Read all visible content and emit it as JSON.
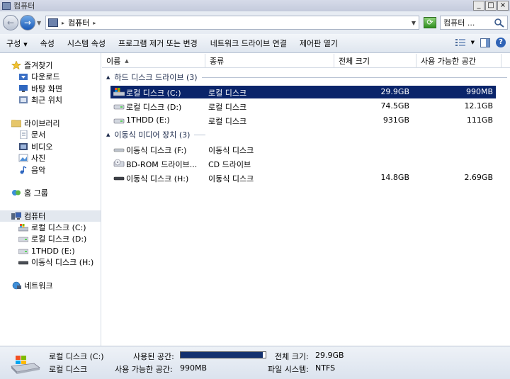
{
  "window": {
    "title": "컴퓨터",
    "buttons": [
      "_",
      "□",
      "×"
    ]
  },
  "address": {
    "location": "컴퓨터",
    "search_value": "컴퓨터 ..."
  },
  "toolbar": {
    "organize": "구성",
    "items": [
      "속성",
      "시스템 속성",
      "프로그램 제거 또는 변경",
      "네트워크 드라이브 연결",
      "제어판 열기"
    ]
  },
  "nav": {
    "favorites": {
      "label": "즐겨찾기",
      "items": [
        "다운로드",
        "바탕 화면",
        "최근 위치"
      ]
    },
    "libraries": {
      "label": "라이브러리",
      "items": [
        "문서",
        "비디오",
        "사진",
        "음악"
      ]
    },
    "homegroup": "홈 그룹",
    "computer": {
      "label": "컴퓨터",
      "items": [
        "로컬 디스크 (C:)",
        "로컬 디스크 (D:)",
        "1THDD (E:)",
        "이동식 디스크 (H:)"
      ]
    },
    "network": "네트워크"
  },
  "columns": {
    "name": "이름",
    "type": "종류",
    "total": "전체 크기",
    "free": "사용 가능한 공간"
  },
  "groups": {
    "hdd": {
      "label": "하드 디스크 드라이브 (3)",
      "rows": [
        {
          "name": "로컬 디스크 (C:)",
          "type": "로컬 디스크",
          "total": "29.9GB",
          "free": "990MB",
          "icon": "system-drive-icon"
        },
        {
          "name": "로컬 디스크 (D:)",
          "type": "로컬 디스크",
          "total": "74.5GB",
          "free": "12.1GB",
          "icon": "hard-drive-icon"
        },
        {
          "name": "1THDD (E:)",
          "type": "로컬 디스크",
          "total": "931GB",
          "free": "111GB",
          "icon": "hard-drive-icon"
        }
      ]
    },
    "removable": {
      "label": "이동식 미디어 장치 (3)",
      "rows": [
        {
          "name": "이동식 디스크 (F:)",
          "type": "이동식 디스크",
          "total": "",
          "free": "",
          "icon": "removable-drive-icon"
        },
        {
          "name": "BD-ROM 드라이브...",
          "type": "CD 드라이브",
          "total": "",
          "free": "",
          "icon": "optical-drive-icon"
        },
        {
          "name": "이동식 디스크 (H:)",
          "type": "이동식 디스크",
          "total": "14.8GB",
          "free": "2.69GB",
          "icon": "removable-drive-icon"
        }
      ]
    }
  },
  "details": {
    "name": "로컬 디스크 (C:)",
    "type": "로컬 디스크",
    "used_label": "사용된 공간:",
    "free_label": "사용 가능한 공간:",
    "free_value": "990MB",
    "total_label": "전체 크기:",
    "total_value": "29.9GB",
    "fs_label": "파일 시스템:",
    "fs_value": "NTFS",
    "used_fraction": 0.968
  },
  "colors": {
    "selection": "#0a246a",
    "usage_bar": "#13306e"
  }
}
